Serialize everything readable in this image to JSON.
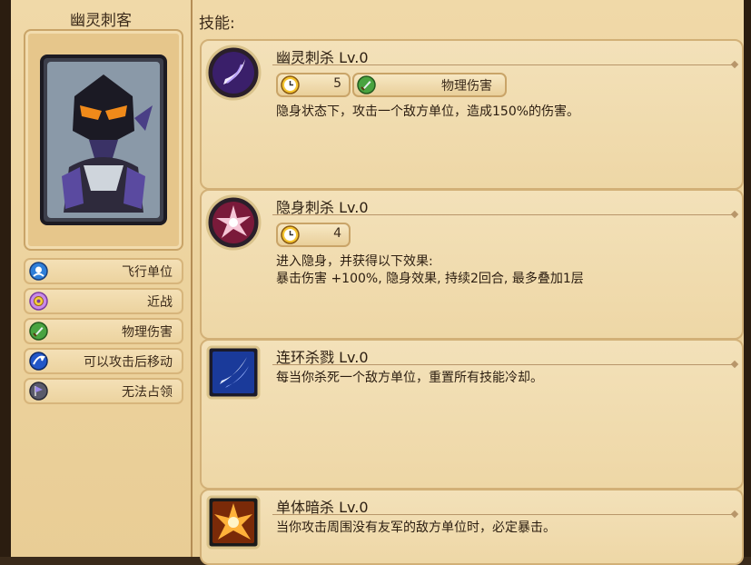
{
  "hero": {
    "name": "幽灵刺客",
    "traits": [
      {
        "icon": "winged-unit-icon",
        "label": "飞行单位",
        "color": "#2f7fd9"
      },
      {
        "icon": "melee-icon",
        "label": "近战",
        "color": "#c98ae8"
      },
      {
        "icon": "sword-icon",
        "label": "物理伤害",
        "color": "#49a340"
      },
      {
        "icon": "move-after-attack-icon",
        "label": "可以攻击后移动",
        "color": "#2257c8"
      },
      {
        "icon": "flag-icon",
        "label": "无法占领",
        "color": "#7a68c8"
      }
    ]
  },
  "skills_heading": "技能:",
  "skills": [
    {
      "title": "幽灵刺杀 Lv.0",
      "cooldown": "5",
      "damage_type": "物理伤害",
      "description": "隐身状态下，攻击一个敌方单位，造成150%的伤害。"
    },
    {
      "title": "隐身刺杀 Lv.0",
      "cooldown": "4",
      "description": "进入隐身，并获得以下效果:\n暴击伤害 +100%, 隐身效果, 持续2回合, 最多叠加1层"
    },
    {
      "title": "连环杀戮 Lv.0",
      "description": "每当你杀死一个敌方单位，重置所有技能冷却。"
    },
    {
      "title": "单体暗杀 Lv.0",
      "description": "当你攻击周围没有友军的敌方单位时，必定暴击。"
    }
  ]
}
